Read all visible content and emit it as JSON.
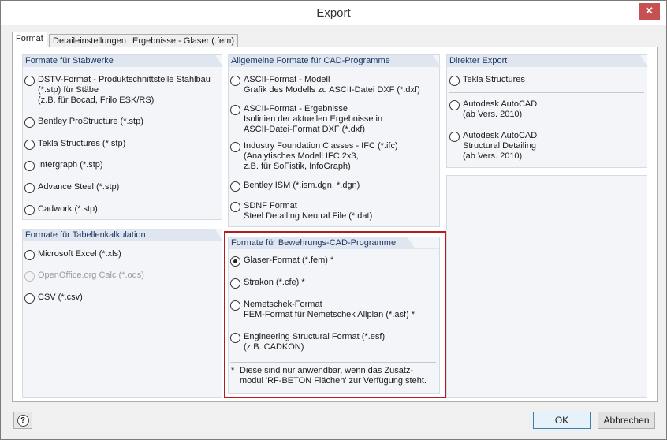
{
  "window": {
    "title": "Export",
    "close_glyph": "✕"
  },
  "tabs": [
    {
      "label": "Format",
      "active": true
    },
    {
      "label": "Detaileinstellungen",
      "active": false
    },
    {
      "label": "Ergebnisse - Glaser (.fem)",
      "active": false
    }
  ],
  "groups": {
    "stabwerke": {
      "title": "Formate für Stabwerke",
      "options": [
        {
          "label": "DSTV-Format - Produktschnittstelle Stahlbau\n(*.stp) für Stäbe\n(z.B. für Bocad, Frilo ESK/RS)",
          "checked": false
        },
        {
          "label": "Bentley ProStructure (*.stp)",
          "checked": false
        },
        {
          "label": "Tekla Structures (*.stp)",
          "checked": false
        },
        {
          "label": "Intergraph (*.stp)",
          "checked": false
        },
        {
          "label": "Advance Steel (*.stp)",
          "checked": false
        },
        {
          "label": "Cadwork (*.stp)",
          "checked": false
        }
      ]
    },
    "tabellen": {
      "title": "Formate für Tabellenkalkulation",
      "options": [
        {
          "label": "Microsoft Excel (*.xls)",
          "checked": false,
          "disabled": false
        },
        {
          "label": "OpenOffice.org Calc (*.ods)",
          "checked": false,
          "disabled": true
        },
        {
          "label": "CSV (*.csv)",
          "checked": false,
          "disabled": false
        }
      ]
    },
    "cad": {
      "title": "Allgemeine Formate für CAD-Programme",
      "options": [
        {
          "label": "ASCII-Format - Modell\nGrafik des Modells zu ASCII-Datei DXF (*.dxf)",
          "checked": false
        },
        {
          "label": "ASCII-Format - Ergebnisse\nIsolinien der aktuellen Ergebnisse in\nASCII-Datei-Format DXF (*.dxf)",
          "checked": false
        },
        {
          "label": "Industry Foundation Classes - IFC (*.ifc)\n(Analytisches Modell IFC 2x3,\nz.B. für SoFistik, InfoGraph)",
          "checked": false
        },
        {
          "label": "Bentley ISM (*.ism.dgn, *.dgn)",
          "checked": false
        },
        {
          "label": "SDNF Format\nSteel Detailing Neutral File (*.dat)",
          "checked": false
        }
      ]
    },
    "bewehrung": {
      "title": "Formate für Bewehrungs-CAD-Programme",
      "options": [
        {
          "label": "Glaser-Format  (*.fem)  *",
          "checked": true
        },
        {
          "label": "Strakon (*.cfe)  *",
          "checked": false
        },
        {
          "label": "Nemetschek-Format\nFEM-Format für Nemetschek Allplan (*.asf)  *",
          "checked": false
        },
        {
          "label": "Engineering Structural Format (*.esf)\n(z.B. CADKON)",
          "checked": false
        }
      ],
      "footnote_marker": "*",
      "footnote": "Diese sind nur anwendbar, wenn das Zusatz-\nmodul 'RF-BETON Flächen' zur Verfügung steht."
    },
    "direkt": {
      "title": "Direkter Export",
      "options": [
        {
          "label": "Tekla Structures",
          "checked": false
        },
        {
          "label": "Autodesk AutoCAD\n(ab Vers. 2010)",
          "checked": false
        },
        {
          "label": "Autodesk AutoCAD\nStructural Detailing\n(ab Vers. 2010)",
          "checked": false
        }
      ]
    }
  },
  "footer": {
    "help_glyph": "?",
    "ok_label": "OK",
    "cancel_label": "Abbrechen"
  }
}
